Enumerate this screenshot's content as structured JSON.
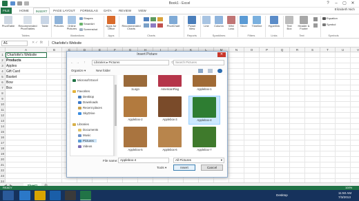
{
  "window": {
    "title": "Book1 - Excel",
    "min": "–",
    "max": "▢",
    "close": "✕"
  },
  "tabs": [
    "FILE",
    "HOME",
    "INSERT",
    "PAGE LAYOUT",
    "FORMULAS",
    "DATA",
    "REVIEW",
    "VIEW"
  ],
  "user": "Elizabeth Nich",
  "ribbon": {
    "pivot": "PivotTable",
    "rec_pivot": "Recommended PivotTables",
    "table": "Table",
    "pictures": "Pictures",
    "online_pictures": "Online Pictures",
    "shapes": "Shapes",
    "smartart": "SmartArt",
    "screenshot": "Screenshot",
    "apps": "Apps for Office",
    "rec_charts": "Recommended Charts",
    "pivotchart": "PivotChart",
    "powerview": "Power View",
    "line": "Line",
    "column": "Column",
    "winloss": "Win/ Loss",
    "slicer": "Slicer",
    "timeline": "Timeline",
    "hyperlink": "Hyperlink",
    "textbox": "Text Box",
    "headerfooter": "Header & Footer",
    "equation": "Equation",
    "symbol": "Symbol",
    "groups": {
      "tables": "Tables",
      "illustrations": "Illustrations",
      "apps": "Apps",
      "charts": "Charts",
      "reports": "Reports",
      "sparklines": "Sparklines",
      "filters": "Filters",
      "links": "Links",
      "text": "Text",
      "symbols": "Symbols"
    }
  },
  "formula_bar": {
    "namebox": "A1",
    "fx": "fx",
    "value": "Charlotte's Website"
  },
  "columns": [
    "A",
    "B",
    "C",
    "D",
    "E",
    "F",
    "G",
    "H",
    "I",
    "J",
    "K",
    "L",
    "M",
    "N",
    "O",
    "P",
    "Q",
    "R",
    "S",
    "T",
    "U",
    "V",
    "W"
  ],
  "rows": [
    "1",
    "2",
    "3",
    "4",
    "5",
    "6",
    "7",
    "8",
    "9",
    "10",
    "11",
    "12",
    "13",
    "14",
    "15",
    "16",
    "17",
    "18",
    "19",
    "20",
    "21",
    "22",
    "23",
    "24",
    "25"
  ],
  "cells": {
    "a1": "Charlotte's Website",
    "a2": "Products",
    "a3": "Apples",
    "a4": "Gift Card",
    "a5": "Basket",
    "a6": "Bow",
    "a7": "Box"
  },
  "sheet_tab": "Sheet1",
  "status": {
    "ready": "READY",
    "zoom": "100%"
  },
  "taskbar": {
    "desktop": "Desktop",
    "time": "11:50 AM",
    "date": "7/3/2013"
  },
  "dialog": {
    "title": "Insert Picture",
    "path": [
      "Libraries",
      "Pictures"
    ],
    "search_placeholder": "Search Pictures",
    "organize": "Organize ▾",
    "new_folder": "New folder",
    "nav": [
      {
        "label": "Microsoft Excel",
        "icon": "excel-icon"
      },
      {
        "label": "Favorites",
        "icon": "star-icon"
      },
      {
        "label": "Desktop",
        "icon": "desktop-icon"
      },
      {
        "label": "Downloads",
        "icon": "downloads-icon"
      },
      {
        "label": "Recent places",
        "icon": "recent-icon"
      },
      {
        "label": "SkyDrive",
        "icon": "cloud-icon"
      },
      {
        "label": "Libraries",
        "icon": "library-icon"
      },
      {
        "label": "Documents",
        "icon": "documents-icon"
      },
      {
        "label": "Music",
        "icon": "music-icon"
      },
      {
        "label": "Pictures",
        "icon": "pictures-icon"
      },
      {
        "label": "Videos",
        "icon": "videos-icon"
      }
    ],
    "files": [
      {
        "name": "1Logo",
        "color": "#9a6a3a"
      },
      {
        "name": "AmericanFlag",
        "color": "#b5354a"
      },
      {
        "name": "Applebox-1",
        "color": "#a06a35"
      },
      {
        "name": "Applebox-2",
        "color": "#b27a3e"
      },
      {
        "name": "Applebox-3",
        "color": "#7a4b2a"
      },
      {
        "name": "Applebox-4",
        "color": "#2e7d32"
      },
      {
        "name": "Applebox-5",
        "color": "#a9743f"
      },
      {
        "name": "Applebox-6",
        "color": "#b8854c"
      },
      {
        "name": "Applebox-7",
        "color": "#3f7a2c"
      }
    ],
    "filename_label": "File name:",
    "filename": "Applebox-4",
    "filter": "All Pictures",
    "tools": "Tools",
    "insert": "Insert",
    "cancel": "Cancel"
  }
}
